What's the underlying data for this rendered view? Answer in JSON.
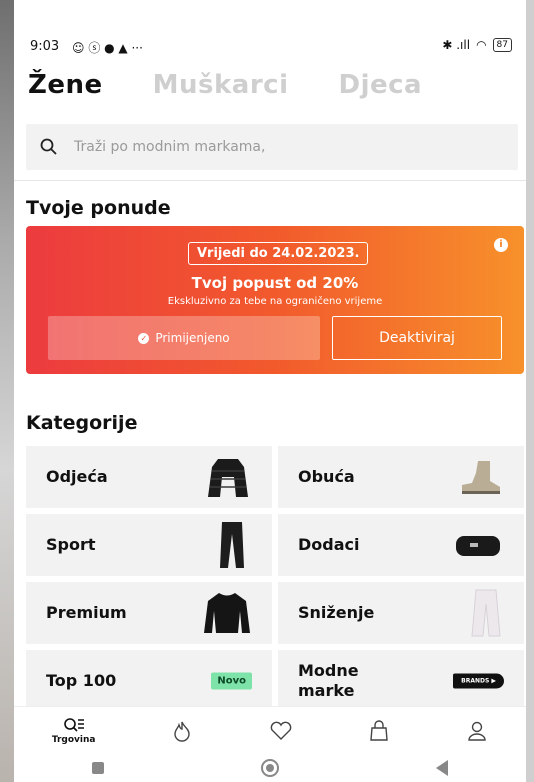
{
  "status_bar": {
    "time": "9:03",
    "left_icons": "☺ ⓢ ● ▲ ···",
    "right_icons": "✱ .ıll",
    "battery": "87"
  },
  "tabs": [
    {
      "label": "Žene"
    },
    {
      "label": "Muškarci"
    },
    {
      "label": "Djeca"
    }
  ],
  "search": {
    "placeholder": "Traži po modnim markama,"
  },
  "offers": {
    "title": "Tvoje ponude",
    "valid_until": "Vrijedi do 24.02.2023.",
    "discount": "Tvoj popust od 20%",
    "exclusive": "Ekskluzivno za tebe na ograničeno vrijeme",
    "applied_label": "Primijenjeno",
    "deactivate_label": "Deaktiviraj"
  },
  "categories": {
    "title": "Kategorije",
    "items": [
      {
        "label": "Odjeća",
        "icon": "jacket-icon"
      },
      {
        "label": "Obuća",
        "icon": "boot-icon"
      },
      {
        "label": "Sport",
        "icon": "leggings-icon"
      },
      {
        "label": "Dodaci",
        "icon": "bag-icon"
      },
      {
        "label": "Premium",
        "icon": "sweater-icon"
      },
      {
        "label": "Sniženje",
        "icon": "trousers-icon"
      },
      {
        "label": "Top 100",
        "badge": "Novo"
      },
      {
        "label": "Modne marke",
        "icon": "brands-tag-icon",
        "tag": "BRANDS ▶"
      }
    ]
  },
  "bottom_nav": {
    "shop_label": "Trgovina"
  },
  "colors": {
    "promo_start": "#ec3b3f",
    "promo_end": "#f7912b",
    "badge": "#7ee3a8"
  }
}
